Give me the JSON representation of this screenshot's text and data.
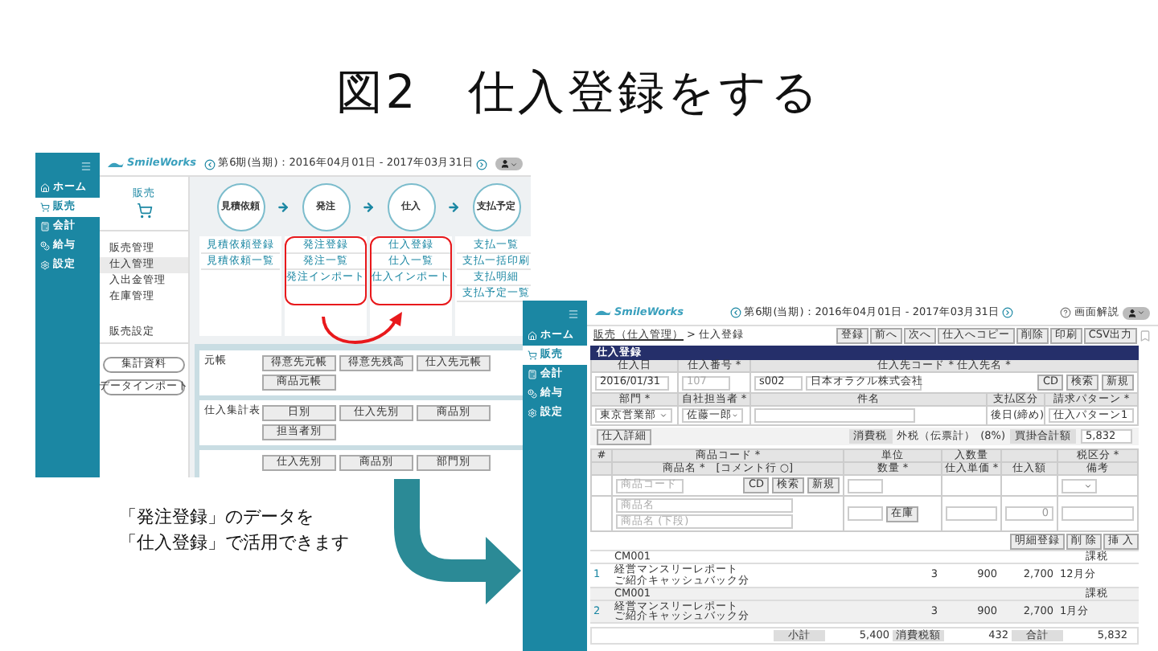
{
  "title": "図2　仕入登録をする",
  "caption": [
    "「発注登録」のデータを",
    "「仕入登録」で活用できます"
  ],
  "left_screen": {
    "nav": [
      {
        "label": "ホーム",
        "selected": false
      },
      {
        "label": "販売",
        "selected": true
      },
      {
        "label": "会計",
        "selected": false
      },
      {
        "label": "給与",
        "selected": false
      },
      {
        "label": "設定",
        "selected": false
      }
    ],
    "logo": "SmileWorks",
    "period": "第6期(当期)：2016年04月01日 - 2017年03月31日",
    "submenu": {
      "title": "販売",
      "items": [
        {
          "label": "販売管理",
          "selected": false
        },
        {
          "label": "仕入管理",
          "selected": true
        },
        {
          "label": "入出金管理",
          "selected": false
        },
        {
          "label": "在庫管理",
          "selected": false
        }
      ],
      "settings": "販売設定",
      "buttons": [
        "集計資料",
        "データインポート"
      ]
    },
    "flow": [
      {
        "step": "見積依頼",
        "links": [
          "見積依頼登録",
          "見積依頼一覧"
        ],
        "highlighted": false
      },
      {
        "step": "発注",
        "links": [
          "発注登録",
          "発注一覧",
          "発注インポート"
        ],
        "highlighted": true
      },
      {
        "step": "仕入",
        "links": [
          "仕入登録",
          "仕入一覧",
          "仕入インポート"
        ],
        "highlighted": true
      },
      {
        "step": "支払予定",
        "links": [
          "支払一覧",
          "支払一括印刷",
          "支払明細",
          "支払予定一覧"
        ],
        "highlighted": false
      }
    ],
    "reports": [
      {
        "label": "元帳",
        "buttons": [
          "得意先元帳",
          "得意先残高",
          "仕入先元帳",
          "商品元帳"
        ]
      },
      {
        "label": "仕入集計表",
        "buttons": [
          "日別",
          "仕入先別",
          "商品別",
          "担当者別"
        ]
      },
      {
        "buttons": [
          "仕入先別",
          "商品別",
          "部門別"
        ]
      }
    ]
  },
  "right_screen": {
    "nav": [
      {
        "label": "ホーム",
        "selected": false
      },
      {
        "label": "販売",
        "selected": true
      },
      {
        "label": "会計",
        "selected": false
      },
      {
        "label": "給与",
        "selected": false
      },
      {
        "label": "設定",
        "selected": false
      }
    ],
    "logo": "SmileWorks",
    "period": "第6期(当期)：2016年04月01日 - 2017年03月31日",
    "help": "画面解説",
    "breadcrumb": {
      "link": "販売（仕入管理）",
      "current": "> 仕入登録"
    },
    "toolbar": [
      "登録",
      "前へ",
      "次へ",
      "仕入へコピー",
      "削除",
      "印刷",
      "CSV出力"
    ],
    "heading": "仕入登録",
    "form": {
      "date": {
        "label": "仕入日",
        "value": "2016/01/31"
      },
      "number": {
        "label": "仕入番号 *",
        "value": "107",
        "disabled": true
      },
      "supplier": {
        "label": "仕入先コード * 仕入先名 *",
        "code": "s002",
        "name": "日本オラクル株式会社"
      },
      "supplier_buttons": [
        "CD",
        "検索",
        "新規"
      ],
      "dept": {
        "label": "部門 *",
        "value": "東京営業部"
      },
      "staff": {
        "label": "自社担当者 *",
        "value": "佐藤一郎"
      },
      "subject": {
        "label": "件名"
      },
      "payment": {
        "label": "支払区分",
        "value": "後日(締め)"
      },
      "billing": {
        "label": "請求パターン *",
        "value": "仕入パターン1"
      }
    },
    "detail_button": "仕入詳細",
    "tax": {
      "label": "消費税",
      "value": "外税（伝票計）",
      "rate": "(8%)"
    },
    "payable": {
      "label": "買掛合計額",
      "value": "5,832"
    },
    "line_header": {
      "top": [
        "#",
        "商品コード *",
        "単位",
        "入数量",
        "税区分 *"
      ],
      "bottom": [
        "商品名 *　[コメント行 ○]",
        "数量 *",
        "仕入単価 *",
        "仕入額",
        "備考"
      ]
    },
    "line_input": {
      "code_placeholder": "商品コード",
      "buttons": [
        "CD",
        "検索",
        "新規"
      ],
      "name_placeholder": "商品名",
      "name2_placeholder": "商品名 (下段)",
      "stock_button": "在庫",
      "amount": "0"
    },
    "actions": [
      "明細登録",
      "削 除",
      "挿 入"
    ],
    "items": [
      {
        "no": "1",
        "code": "CM001",
        "tax": "課税",
        "name": "経営マンスリーレポート",
        "name2": "ご紹介キャッシュバック分",
        "qty": "3",
        "price": "900",
        "amount": "2,700",
        "note": "12月分"
      },
      {
        "no": "2",
        "code": "CM001",
        "tax": "課税",
        "name": "経営マンスリーレポート",
        "name2": "ご紹介キャッシュバック分",
        "qty": "3",
        "price": "900",
        "amount": "2,700",
        "note": "1月分"
      }
    ],
    "totals": [
      {
        "label": "小計",
        "value": "5,400"
      },
      {
        "label": "消費税額",
        "value": "432"
      },
      {
        "label": "合計",
        "value": "5,832"
      }
    ]
  }
}
